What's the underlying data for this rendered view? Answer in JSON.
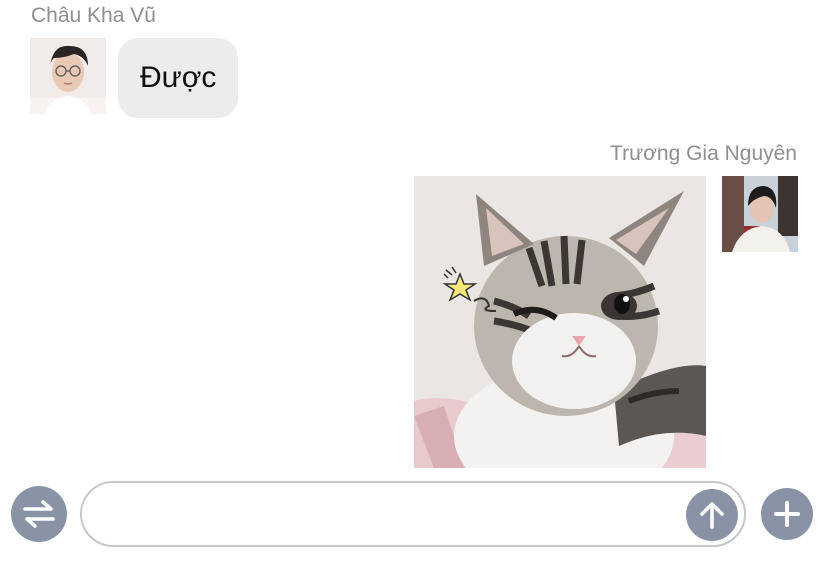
{
  "messages": [
    {
      "sender": "Châu Kha Vũ",
      "text": "Được",
      "avatar_icon": "avatar-glasses-person",
      "direction": "incoming"
    },
    {
      "sender": "Trương Gia Nguyên",
      "sticker_icon": "winking-cat-sticker",
      "avatar_icon": "avatar-person-outdoor",
      "direction": "outgoing"
    }
  ],
  "composer": {
    "value": "",
    "placeholder": "",
    "switch_icon": "swap-arrows-icon",
    "send_icon": "arrow-up-icon",
    "add_icon": "plus-icon"
  },
  "colors": {
    "background": "#ffffff",
    "bubble_incoming": "#ececec",
    "name_text": "#8e8e93",
    "button": "#8a93a6",
    "input_border": "#c4c7cc"
  }
}
